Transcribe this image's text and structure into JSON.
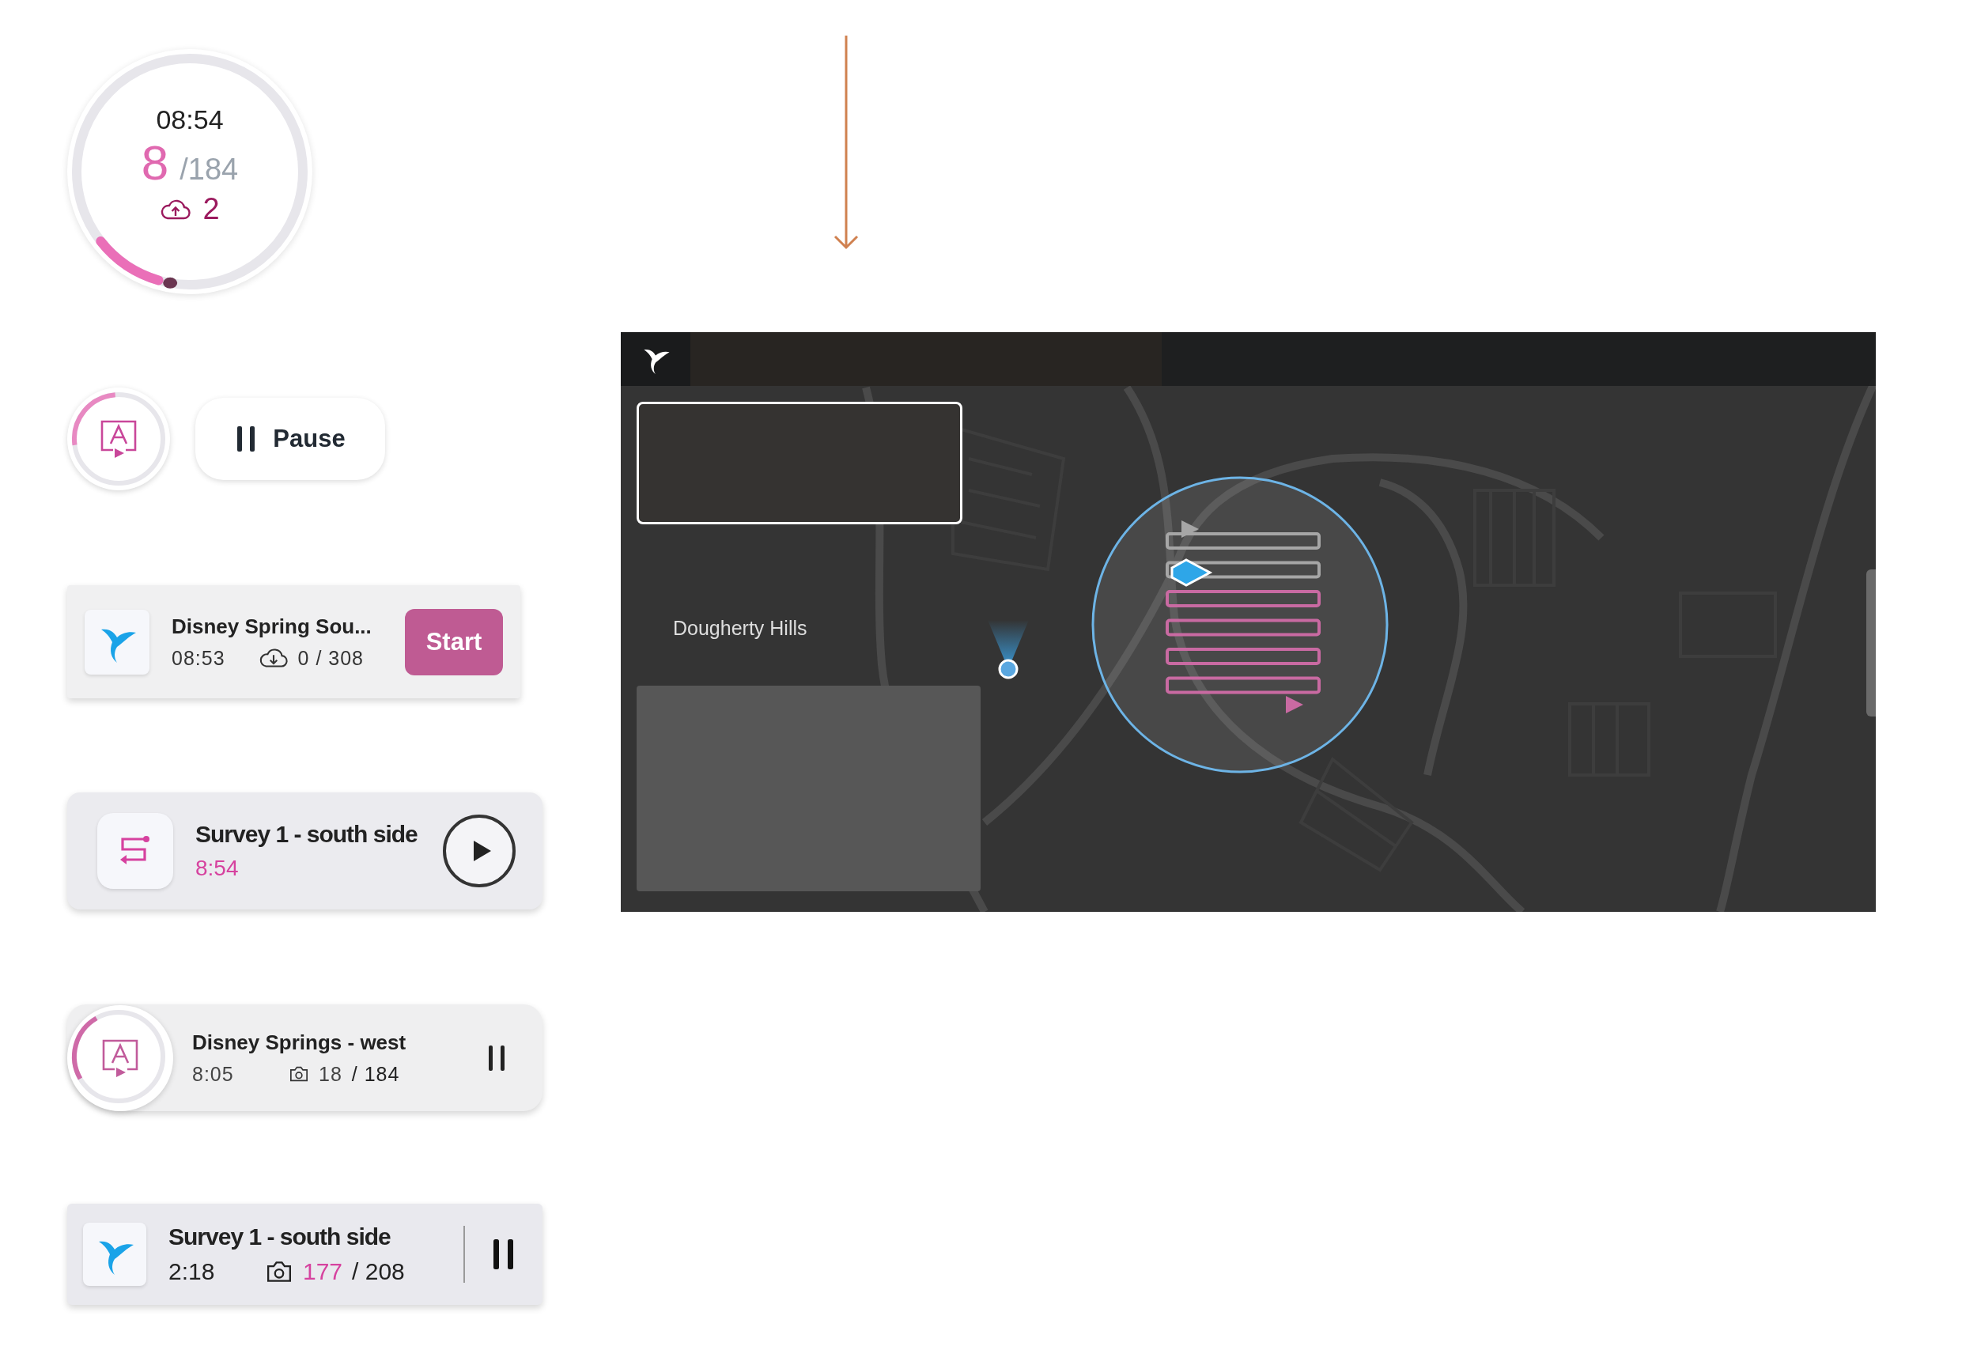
{
  "timer_gauge": {
    "time": "08:54",
    "count": "8",
    "total": "/184",
    "uploads": "2",
    "level": 0.1
  },
  "progress_button": {
    "level": 0.26
  },
  "pause_button": {
    "label": "Pause"
  },
  "cards": [
    {
      "kind": "start",
      "title": "Disney Spring Sou...",
      "time": "08:53",
      "count": "0 / 308",
      "button": "Start"
    },
    {
      "kind": "play",
      "title": "Survey 1 - south side",
      "time": "8:54"
    },
    {
      "kind": "progress",
      "title": "Disney Springs - west",
      "time": "8:05",
      "done": "18",
      "total": "/ 184",
      "level": 0.25
    },
    {
      "kind": "active",
      "title": "Survey 1 - south side",
      "time": "2:18",
      "done": "177",
      "total": "/ 208"
    }
  ],
  "map": {
    "place_label": "Dougherty Hills"
  }
}
